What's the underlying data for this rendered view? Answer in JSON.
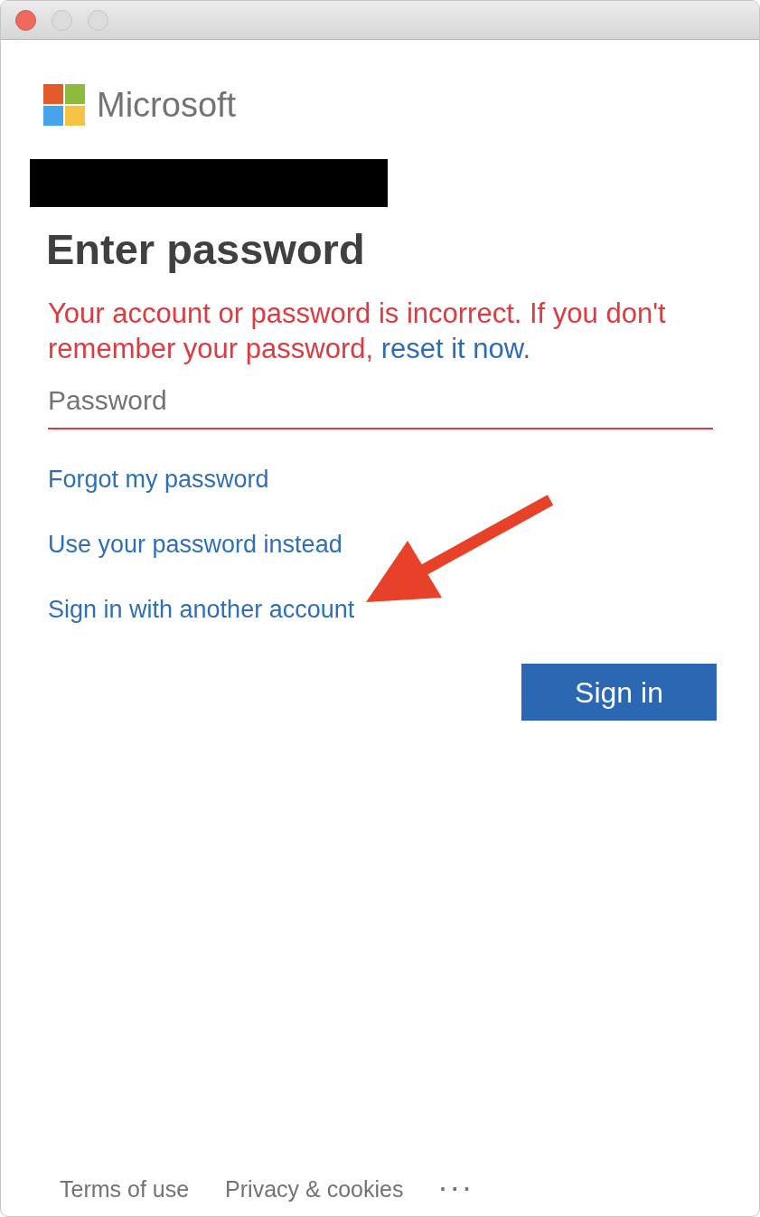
{
  "window": {
    "controls": [
      {
        "kind": "close",
        "disabled": false
      },
      {
        "kind": "minimize",
        "disabled": true
      },
      {
        "kind": "zoom",
        "disabled": true
      }
    ]
  },
  "brand": {
    "name": "Microsoft"
  },
  "account": {
    "redacted": true
  },
  "heading": "Enter password",
  "error": {
    "text": "Your account or password is incorrect. If you don't remember your password,",
    "link": "reset it now."
  },
  "password_field": {
    "placeholder": "Password",
    "invalid": true
  },
  "links": [
    "Forgot my password",
    "Use your password instead",
    "Sign in with another account"
  ],
  "primary_button": "Sign in",
  "footer": {
    "links": [
      "Terms of use",
      "Privacy & cookies"
    ],
    "more": "···"
  },
  "annotations": [
    {
      "kind": "arrow"
    }
  ]
}
